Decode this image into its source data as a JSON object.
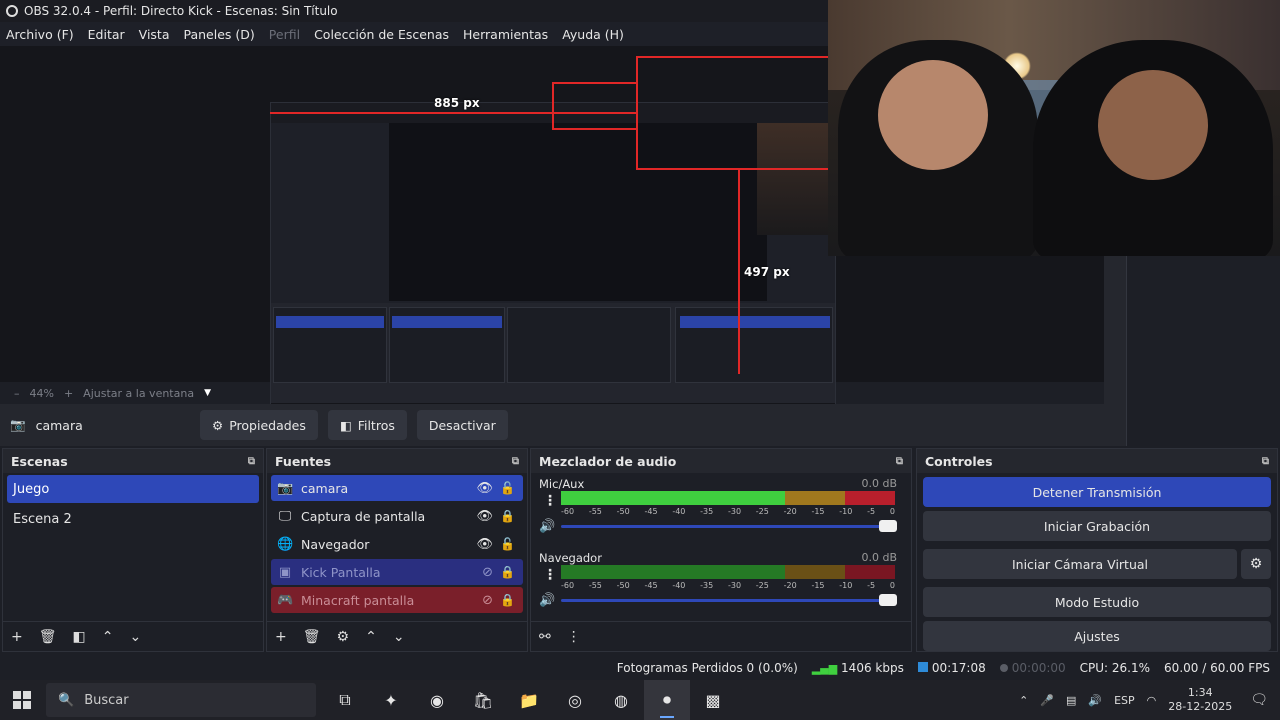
{
  "window": {
    "title": "OBS 32.0.4 - Perfil: Directo Kick - Escenas: Sin Título"
  },
  "menu": [
    {
      "label": "Archivo (F)",
      "enabled": true
    },
    {
      "label": "Editar",
      "enabled": true
    },
    {
      "label": "Vista",
      "enabled": true
    },
    {
      "label": "Paneles (D)",
      "enabled": true
    },
    {
      "label": "Perfil",
      "enabled": false
    },
    {
      "label": "Colección de Escenas",
      "enabled": true
    },
    {
      "label": "Herramientas",
      "enabled": true
    },
    {
      "label": "Ayuda (H)",
      "enabled": true
    }
  ],
  "preview": {
    "measure_width": "885 px",
    "measure_height": "497 px"
  },
  "zoom": {
    "level": "44%",
    "fit_label": "Ajustar a la ventana"
  },
  "source_toolbar": {
    "current_source": "camara",
    "properties_label": "Propiedades",
    "filters_label": "Filtros",
    "deactivate_label": "Desactivar"
  },
  "scenes": {
    "title": "Escenas",
    "items": [
      {
        "label": "Juego",
        "selected": true
      },
      {
        "label": "Escena 2",
        "selected": false
      }
    ]
  },
  "sources": {
    "title": "Fuentes",
    "items": [
      {
        "label": "camara",
        "icon": "camera-icon"
      },
      {
        "label": "Captura de pantalla",
        "icon": "monitor-icon"
      },
      {
        "label": "Navegador",
        "icon": "globe-icon"
      },
      {
        "label": "Kick Pantalla",
        "icon": "window-icon"
      },
      {
        "label": "Minacraft pantalla",
        "icon": "gamepad-icon"
      }
    ]
  },
  "mixer": {
    "title": "Mezclador de audio",
    "channels": [
      {
        "name": "Mic/Aux",
        "db": "0.0 dB"
      },
      {
        "name": "Navegador",
        "db": "0.0 dB"
      }
    ],
    "ticks": [
      "-60",
      "-55",
      "-50",
      "-45",
      "-40",
      "-35",
      "-30",
      "-25",
      "-20",
      "-15",
      "-10",
      "-5",
      "0"
    ]
  },
  "controls": {
    "title": "Controles",
    "stop_stream": "Detener Transmisión",
    "start_recording": "Iniciar Grabación",
    "start_virtual_cam": "Iniciar Cámara Virtual",
    "studio_mode": "Modo Estudio",
    "settings": "Ajustes"
  },
  "status": {
    "dropped_frames": "Fotogramas Perdidos 0 (0.0%)",
    "bitrate": "1406 kbps",
    "live_time": "00:17:08",
    "rec_time": "00:00:00",
    "cpu": "CPU: 26.1%",
    "fps": "60.00 / 60.00 FPS"
  },
  "taskbar": {
    "search_placeholder": "Buscar",
    "language": "ESP",
    "time": "1:34",
    "date": "28-12-2025"
  },
  "colors": {
    "accent": "#2e48b8",
    "meter_green": "#3fcf3f",
    "meter_yellow": "#a0781e",
    "meter_red": "#b81f2c",
    "guide_red": "#e12727"
  }
}
